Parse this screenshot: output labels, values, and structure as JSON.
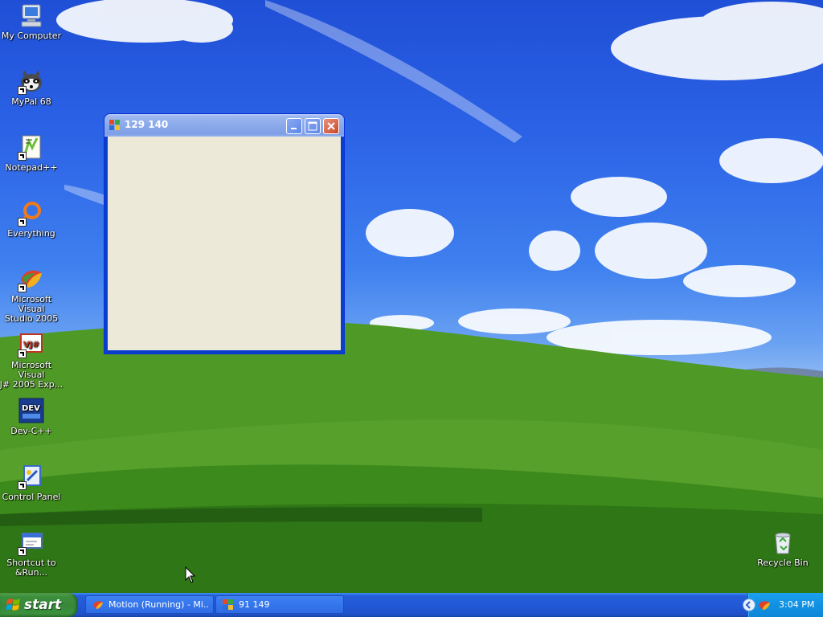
{
  "desktop": {
    "icons": [
      {
        "label": "My Computer",
        "icon": "my-computer-icon"
      },
      {
        "label": "MyPal 68",
        "icon": "mypal-icon"
      },
      {
        "label": "Notepad++",
        "icon": "notepad-plus-plus-icon"
      },
      {
        "label": "Everything",
        "icon": "everything-search-icon"
      },
      {
        "label": "Microsoft Visual\nStudio 2005",
        "icon": "visual-studio-icon"
      },
      {
        "label": "Microsoft Visual\nJ# 2005 Exp...",
        "icon": "visual-jsharp-icon"
      },
      {
        "label": "Dev-C++",
        "icon": "dev-cpp-icon"
      },
      {
        "label": "Control Panel",
        "icon": "control-panel-icon"
      },
      {
        "label": "Shortcut to\n&Run...",
        "icon": "run-shortcut-icon"
      }
    ],
    "recycle_bin": {
      "label": "Recycle Bin",
      "icon": "recycle-bin-icon"
    }
  },
  "window": {
    "title": "129 140",
    "icon": "app-window-icon",
    "buttons": {
      "minimize": "minimize-icon",
      "maximize": "maximize-icon",
      "close": "close-icon"
    }
  },
  "taskbar": {
    "start_label": "start",
    "tasks": [
      {
        "label": "Motion (Running) - Mi...",
        "icon": "visual-studio-icon"
      },
      {
        "label": "91 149",
        "icon": "app-window-icon"
      }
    ],
    "clock": "3:04 PM",
    "colors": {
      "taskbar": "#245edb",
      "start": "#3c8f3b",
      "tray": "#1191e2"
    }
  }
}
